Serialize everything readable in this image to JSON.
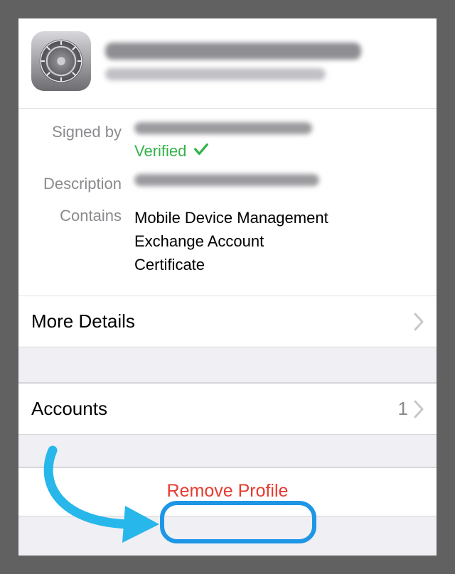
{
  "header": {
    "title_redacted": true,
    "subtitle_redacted": true
  },
  "info": {
    "signed_by_label": "Signed by",
    "signed_by_redacted": true,
    "verified_label": "Verified",
    "description_label": "Description",
    "description_redacted": true,
    "contains_label": "Contains",
    "contains_lines": [
      "Mobile Device Management",
      "Exchange Account",
      "Certificate"
    ]
  },
  "nav": {
    "more_details": "More Details",
    "accounts": "Accounts",
    "accounts_count": "1"
  },
  "actions": {
    "remove_profile": "Remove Profile"
  }
}
